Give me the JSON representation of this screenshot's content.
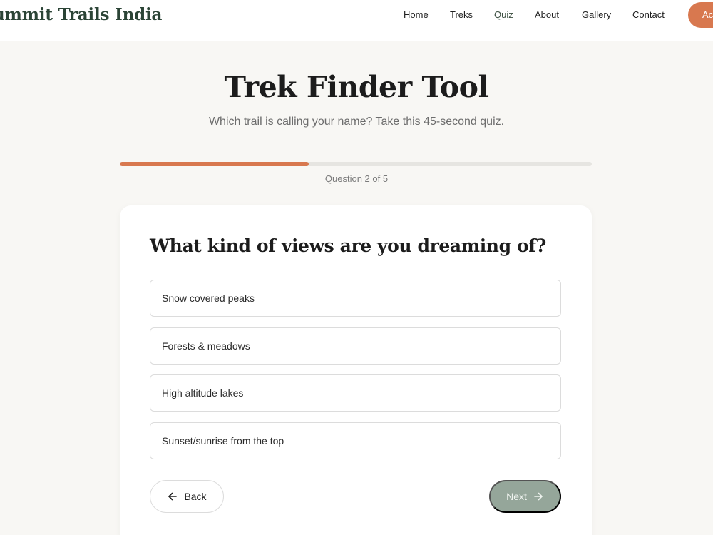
{
  "header": {
    "brand": "ummit Trails India",
    "nav": [
      {
        "label": "Home",
        "active": false
      },
      {
        "label": "Treks",
        "active": false
      },
      {
        "label": "Quiz",
        "active": true
      },
      {
        "label": "About",
        "active": false
      },
      {
        "label": "Gallery",
        "active": false
      },
      {
        "label": "Contact",
        "active": false
      }
    ],
    "cta_label": "Ac"
  },
  "hero": {
    "title": "Trek Finder Tool",
    "subtitle": "Which trail is calling your name? Take this 45-second quiz."
  },
  "progress": {
    "current": 2,
    "total": 5,
    "fraction": 0.4,
    "label": "Question 2 of 5"
  },
  "quiz": {
    "question": "What kind of views are you dreaming of?",
    "options": [
      "Snow covered peaks",
      "Forests & meadows",
      "High altitude lakes",
      "Sunset/sunrise from the top"
    ],
    "back_label": "Back",
    "next_label": "Next"
  },
  "colors": {
    "accent": "#d8784f",
    "brand": "#2b4436",
    "next_button": "#95a69a",
    "background": "#f8f7f4"
  },
  "icons": {
    "back": "arrow-left-icon",
    "next": "arrow-right-icon"
  }
}
